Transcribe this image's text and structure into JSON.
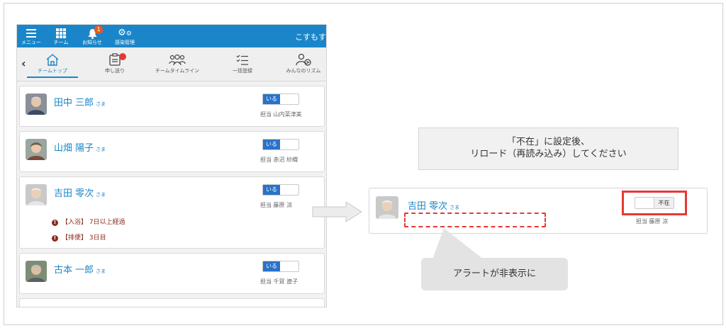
{
  "topbar": {
    "menu_label": "メニュー",
    "team_label": "チーム",
    "notice_label": "お知らせ",
    "notice_badge": "1",
    "infection_label": "感染管理",
    "user_name": "こすもす"
  },
  "tabs": [
    {
      "label": "チームトップ",
      "active": true
    },
    {
      "label": "申し送り",
      "active": false
    },
    {
      "label": "チームタイムライン",
      "active": false
    },
    {
      "label": "一括登録",
      "active": false
    },
    {
      "label": "みんなのリズム",
      "active": false
    }
  ],
  "status_present": "いる",
  "status_absent": "不在",
  "sama": "さま",
  "residents": [
    {
      "name": "田中 三郎",
      "staff": "担当 山内菜津美"
    },
    {
      "name": "山畑 陽子",
      "staff": "担当 赤沼 紗織"
    },
    {
      "name": "吉田 零次",
      "staff": "担当 藤原 涼",
      "alerts": [
        "【入浴】 7日以上経過",
        "【排便】 3日目"
      ]
    },
    {
      "name": "古本 一郎",
      "staff": "担当 千賀 遼子"
    }
  ],
  "instruction": {
    "line1": "「不在」に設定後、",
    "line2": "リロード（再読み込み）してください"
  },
  "after": {
    "name": "吉田 零次",
    "staff": "担当 藤原 涼"
  },
  "callout": "アラートが非表示に",
  "colors": {
    "brand_blue": "#1a86c9",
    "toggle_blue": "#2a72c9",
    "alert_red": "#8b2b1f",
    "highlight_red": "#e53935"
  }
}
